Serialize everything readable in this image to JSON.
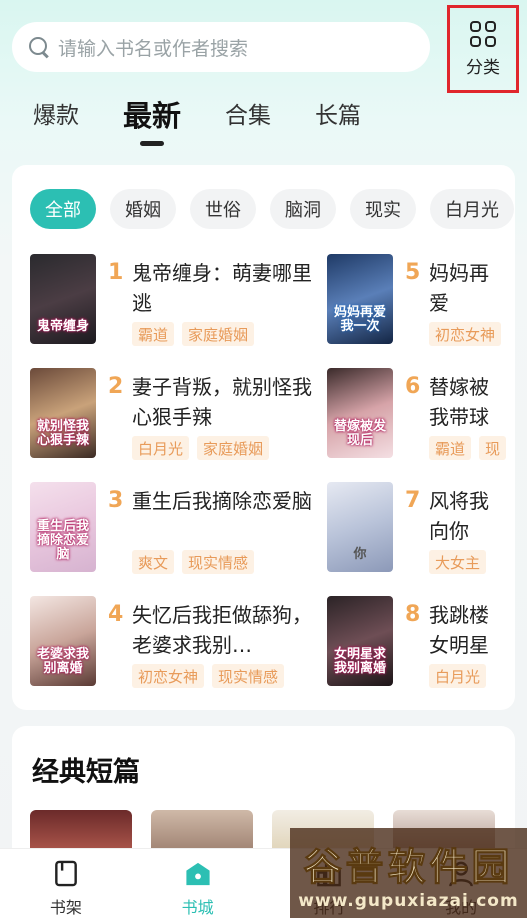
{
  "search": {
    "placeholder": "请输入书名或作者搜索"
  },
  "category_button": {
    "label": "分类"
  },
  "tabs": [
    {
      "label": "爆款",
      "active": false
    },
    {
      "label": "最新",
      "active": true
    },
    {
      "label": "合集",
      "active": false
    },
    {
      "label": "长篇",
      "active": false
    }
  ],
  "filters": [
    {
      "label": "全部",
      "active": true
    },
    {
      "label": "婚姻"
    },
    {
      "label": "世俗"
    },
    {
      "label": "脑洞"
    },
    {
      "label": "现实"
    },
    {
      "label": "白月光"
    }
  ],
  "books": [
    {
      "rank": "1",
      "title": "鬼帝缠身：萌妻哪里逃",
      "cover_text": "鬼帝缠身",
      "tags": [
        "霸道",
        "家庭婚姻"
      ]
    },
    {
      "rank": "2",
      "title": "妻子背叛，就别怪我心狠手辣",
      "cover_text": "就别怪我心狠手辣",
      "tags": [
        "白月光",
        "家庭婚姻"
      ]
    },
    {
      "rank": "3",
      "title": "重生后我摘除恋爱脑",
      "cover_text": "重生后我摘除恋爱脑",
      "tags": [
        "爽文",
        "现实情感"
      ]
    },
    {
      "rank": "4",
      "title": "失忆后我拒做舔狗，老婆求我别…",
      "cover_text": "老婆求我别离婚",
      "tags": [
        "初恋女神",
        "现实情感"
      ]
    },
    {
      "rank": "5",
      "title": "妈妈再爱",
      "cover_text": "妈妈再爱我一次",
      "tags": [
        "初恋女神"
      ]
    },
    {
      "rank": "6",
      "title": "替嫁被我带球",
      "cover_text": "替嫁被发现后",
      "tags": [
        "霸道",
        "现"
      ]
    },
    {
      "rank": "7",
      "title": "风将我向你",
      "cover_text": "你",
      "tags": [
        "大女主"
      ]
    },
    {
      "rank": "8",
      "title": "我跳楼女明星",
      "cover_text": "女明星求我别离婚",
      "tags": [
        "白月光"
      ]
    }
  ],
  "section": {
    "title": "经典短篇"
  },
  "bottom_nav": [
    {
      "label": "书架",
      "icon": "bookshelf-icon",
      "active": false
    },
    {
      "label": "书城",
      "icon": "bookstore-icon",
      "active": true
    },
    {
      "label": "排行",
      "icon": "ranking-icon",
      "active": false
    },
    {
      "label": "我的",
      "icon": "profile-icon",
      "active": false
    }
  ],
  "watermark": {
    "title": "谷普软件园",
    "url": "www.gupuxiazai.com"
  },
  "colors": {
    "accent": "#2cbfb3",
    "rank": "#f0a656",
    "tag_text": "#e89b5a",
    "tag_bg": "#fdf1e4",
    "highlight_border": "#e0262c"
  }
}
